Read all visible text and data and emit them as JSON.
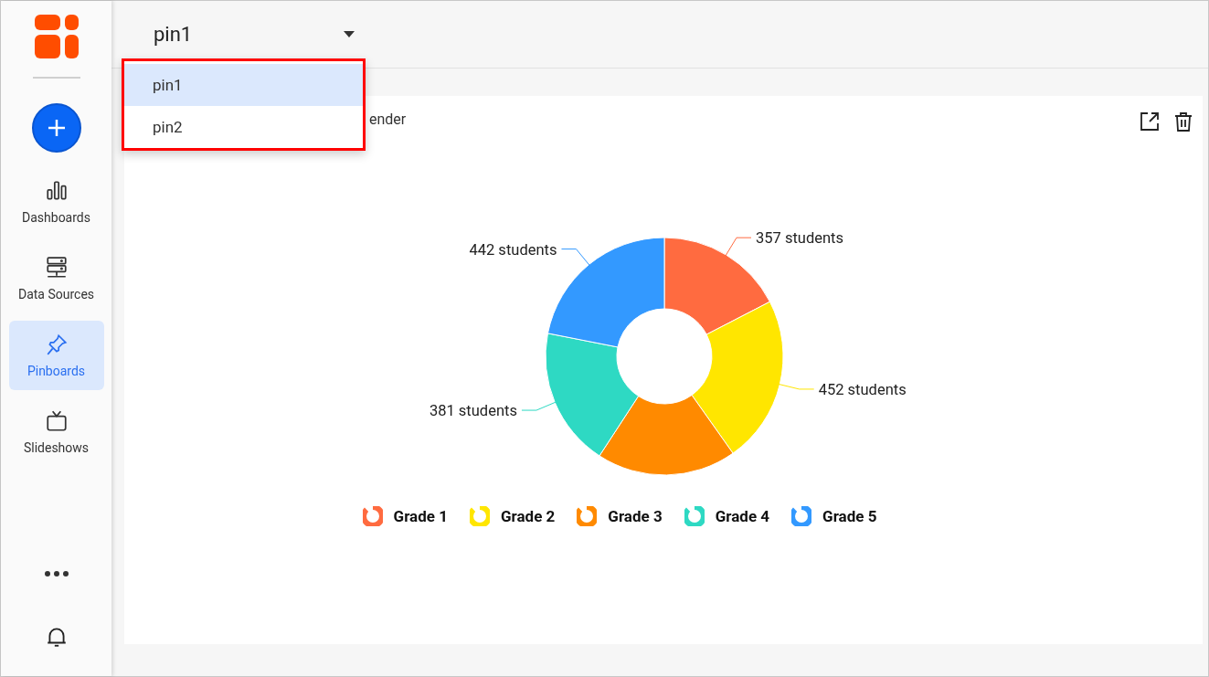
{
  "sidebar": {
    "items": [
      {
        "label": "Dashboards",
        "selected": false
      },
      {
        "label": "Data Sources",
        "selected": false
      },
      {
        "label": "Pinboards",
        "selected": true
      },
      {
        "label": "Slideshows",
        "selected": false
      }
    ]
  },
  "header": {
    "select_value": "pin1"
  },
  "dropdown": {
    "options": [
      {
        "label": "pin1",
        "selected": true
      },
      {
        "label": "pin2",
        "selected": false
      }
    ]
  },
  "card": {
    "title": "ender",
    "chart_data": {
      "type": "donut",
      "categories": [
        "Grade 1",
        "Grade 2",
        "Grade 3",
        "Grade 4",
        "Grade 5"
      ],
      "series": [
        {
          "values": [
            17.4,
            22.8,
            19.0,
            18.9,
            21.9
          ]
        }
      ],
      "colors": [
        "#ff6b40",
        "#ffe600",
        "#ff8a00",
        "#2ed9c3",
        "#3399ff"
      ],
      "value_labels": [
        "357 students",
        "452 students",
        null,
        "381 students",
        "442 students"
      ]
    }
  }
}
